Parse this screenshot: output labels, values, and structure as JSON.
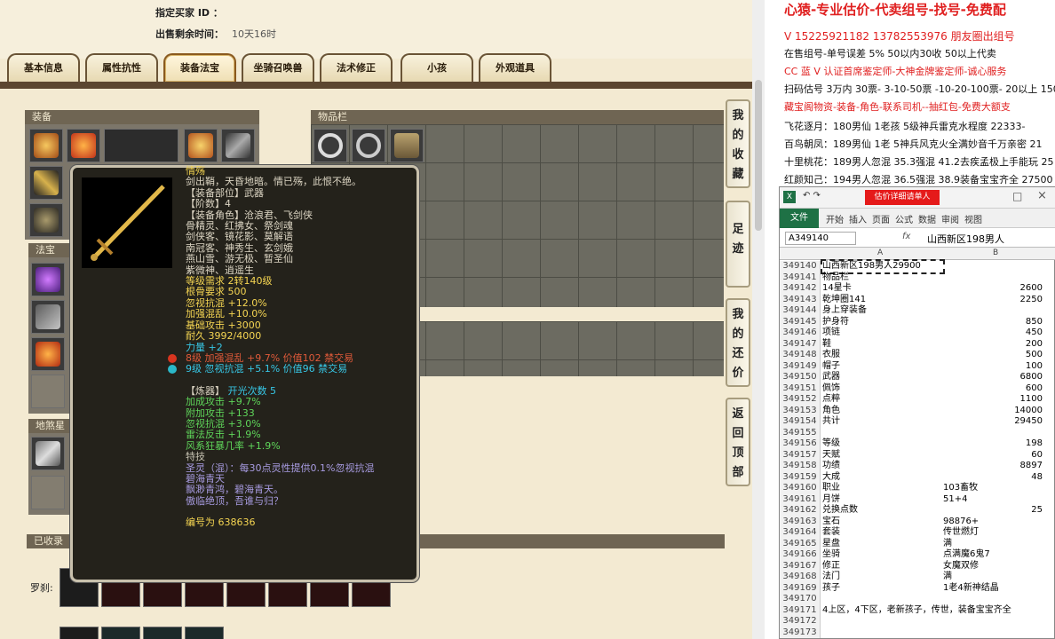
{
  "header": {
    "buyer_label": "指定买家 ID ：",
    "time_label": "出售剩余时间：",
    "time_value": "10天16时"
  },
  "tabs": [
    "基本信息",
    "属性抗性",
    "装备法宝",
    "坐骑召唤兽",
    "法术修正",
    "小孩",
    "外观道具"
  ],
  "active_tab": "装备法宝",
  "panels": {
    "equip": "装备",
    "items": "物品栏",
    "fabao": "法宝",
    "dishaxing": "地煞星",
    "collected": "已收录",
    "luocha": "罗刹:"
  },
  "side_buttons": [
    "我的收藏",
    "足迹",
    "我的还价",
    "返回顶部"
  ],
  "tooltip": {
    "name": "情殇",
    "desc": "剑出鞘，天昏地暗。情已殇，此恨不绝。",
    "part": "【装备部位】武器",
    "tier": "【阶数】4",
    "roles_label": "【装备角色】沧浪君、飞剑侠",
    "roles": [
      "骨精灵、红拂女、祭剑魂",
      "剑侠客、镜花影、莫解语",
      "南冠客、神秀生、玄剑娥",
      "燕山雪、游无极、暂圣仙",
      "紫微神、逍遥生"
    ],
    "req_level": "等级需求 2转140级",
    "req_bone": "根骨要求 500",
    "stats": [
      "忽视抗混 +12.0%",
      "加强混乱 +10.0%",
      "基础攻击 +3000",
      "耐久 3992/4000"
    ],
    "power": "力量 +2",
    "gems": [
      {
        "text": "8级 加强混乱 +9.7% 价值102 禁交易",
        "color": "#e05a3a"
      },
      {
        "text": "9级 忽视抗混 +5.1% 价值96 禁交易",
        "color": "#37c7e6"
      }
    ],
    "refine_label": "【炼器】",
    "refine_count": "开光次数 5",
    "refine_stats": [
      "加成攻击 +9.7%",
      "附加攻击 +133",
      "忽视抗混 +3.0%",
      "雷法反击 +1.9%",
      "风系狂暴几率 +1.9%"
    ],
    "special_label": "特技",
    "special": "圣灵（混）：每30点灵性提供0.1%忽视抗混",
    "suit": "碧海青天",
    "poem1": "飘渺青鸿，碧海青天。",
    "poem2": "傲临绝顶，吾谁与归？",
    "id": "编号为 638636"
  },
  "right": {
    "lines": [
      {
        "text": "心猿-专业估价-代卖组号-找号-免费配",
        "color": "#e02020"
      },
      {
        "text": "V 15225921182   13782553976 朋友圈出组号",
        "color": "#e02020"
      },
      {
        "text": "在售组号-单号误差 5%   50以内30收 50以上代卖",
        "color": "#111111"
      },
      {
        "text": "CC 蓝 V 认证首席鉴定师-大神金牌鉴定师-诚心服务",
        "color": "#e02020"
      },
      {
        "text": "扫码估号 3万内 30票- 3-10-50票  -10-20-100票- 20以上 150",
        "color": "#111111"
      },
      {
        "text": "藏宝阁物资-装备-角色-联系司机--抽红包-免费大额支",
        "color": "#e02020"
      },
      {
        "text": "飞花逐月：180男仙 1老孩 5级神兵雷克水程度 22333-",
        "color": "#111111"
      },
      {
        "text": "百鸟朝凤：189男仙 1老 5神兵风克火全满妙音千万亲密 21",
        "color": "#111111"
      },
      {
        "text": "十里桃花：189男人忽混 35.3强混 41.2去疾孟极上手能玩 25",
        "color": "#111111"
      },
      {
        "text": "红颜知己：194男人忽混 36.5强混 38.9装备宝宝齐全 27500",
        "color": "#111111"
      }
    ],
    "excel": {
      "save_btn": "估价详细请单人",
      "tabs": [
        "文件",
        "开始",
        "插入",
        "页面",
        "公式",
        "数据",
        "审阅",
        "视图"
      ],
      "namebox": "A349140",
      "fx": "fx",
      "formula": "山西新区198男人",
      "col_a": "A",
      "col_b": "B",
      "rows": [
        {
          "n": "349140",
          "a": "山西新区198男人29900",
          "b": "",
          "r": false
        },
        {
          "n": "349141",
          "a": "物品栏",
          "b": "",
          "r": false
        },
        {
          "n": "349142",
          "a": "14星卡",
          "b": "2600",
          "r": true
        },
        {
          "n": "349143",
          "a": "乾坤圈141",
          "b": "2250",
          "r": true
        },
        {
          "n": "349144",
          "a": "身上穿装备",
          "b": "",
          "r": false
        },
        {
          "n": "349145",
          "a": "护身符",
          "b": "850",
          "r": true
        },
        {
          "n": "349146",
          "a": "项链",
          "b": "450",
          "r": true
        },
        {
          "n": "349147",
          "a": "鞋",
          "b": "200",
          "r": true
        },
        {
          "n": "349148",
          "a": "衣服",
          "b": "500",
          "r": true
        },
        {
          "n": "349149",
          "a": "帽子",
          "b": "100",
          "r": true
        },
        {
          "n": "349150",
          "a": "武器",
          "b": "6800",
          "r": true
        },
        {
          "n": "349151",
          "a": "佩饰",
          "b": "600",
          "r": true
        },
        {
          "n": "349152",
          "a": "点粹",
          "b": "1100",
          "r": true
        },
        {
          "n": "349153",
          "a": "角色",
          "b": "14000",
          "r": true
        },
        {
          "n": "349154",
          "a": "共计",
          "b": "29450",
          "r": true
        },
        {
          "n": "349155",
          "a": "",
          "b": "",
          "r": false
        },
        {
          "n": "349156",
          "a": "等级",
          "b": "198",
          "r": true
        },
        {
          "n": "349157",
          "a": "天赋",
          "b": "60",
          "r": true
        },
        {
          "n": "349158",
          "a": "功绩",
          "b": "8897",
          "r": true
        },
        {
          "n": "349159",
          "a": "大成",
          "b": "48",
          "r": true
        },
        {
          "n": "349160",
          "a": "职业",
          "b": "103畜牧",
          "r": false
        },
        {
          "n": "349161",
          "a": "月饼",
          "b": "51+4",
          "r": false
        },
        {
          "n": "349162",
          "a": "兑换点数",
          "b": "25",
          "r": true
        },
        {
          "n": "349163",
          "a": "宝石",
          "b": "98876+",
          "r": false
        },
        {
          "n": "349164",
          "a": "套装",
          "b": "传世燃灯",
          "r": false
        },
        {
          "n": "349165",
          "a": "星盘",
          "b": "满",
          "r": false
        },
        {
          "n": "349166",
          "a": "坐骑",
          "b": "点满魔6鬼7",
          "r": false
        },
        {
          "n": "349167",
          "a": "修正",
          "b": "女魔双修",
          "r": false
        },
        {
          "n": "349168",
          "a": "法门",
          "b": "满",
          "r": false
        },
        {
          "n": "349169",
          "a": "孩子",
          "b": "1老4新神结晶",
          "r": false
        },
        {
          "n": "349170",
          "a": "",
          "b": "",
          "r": false
        },
        {
          "n": "349171",
          "a": "4上区，4下区，老新孩子，传世，装备宝宝齐全",
          "b": "",
          "r": false
        },
        {
          "n": "349172",
          "a": "",
          "b": "",
          "r": false
        },
        {
          "n": "349173",
          "a": "",
          "b": "",
          "r": false
        }
      ]
    }
  }
}
